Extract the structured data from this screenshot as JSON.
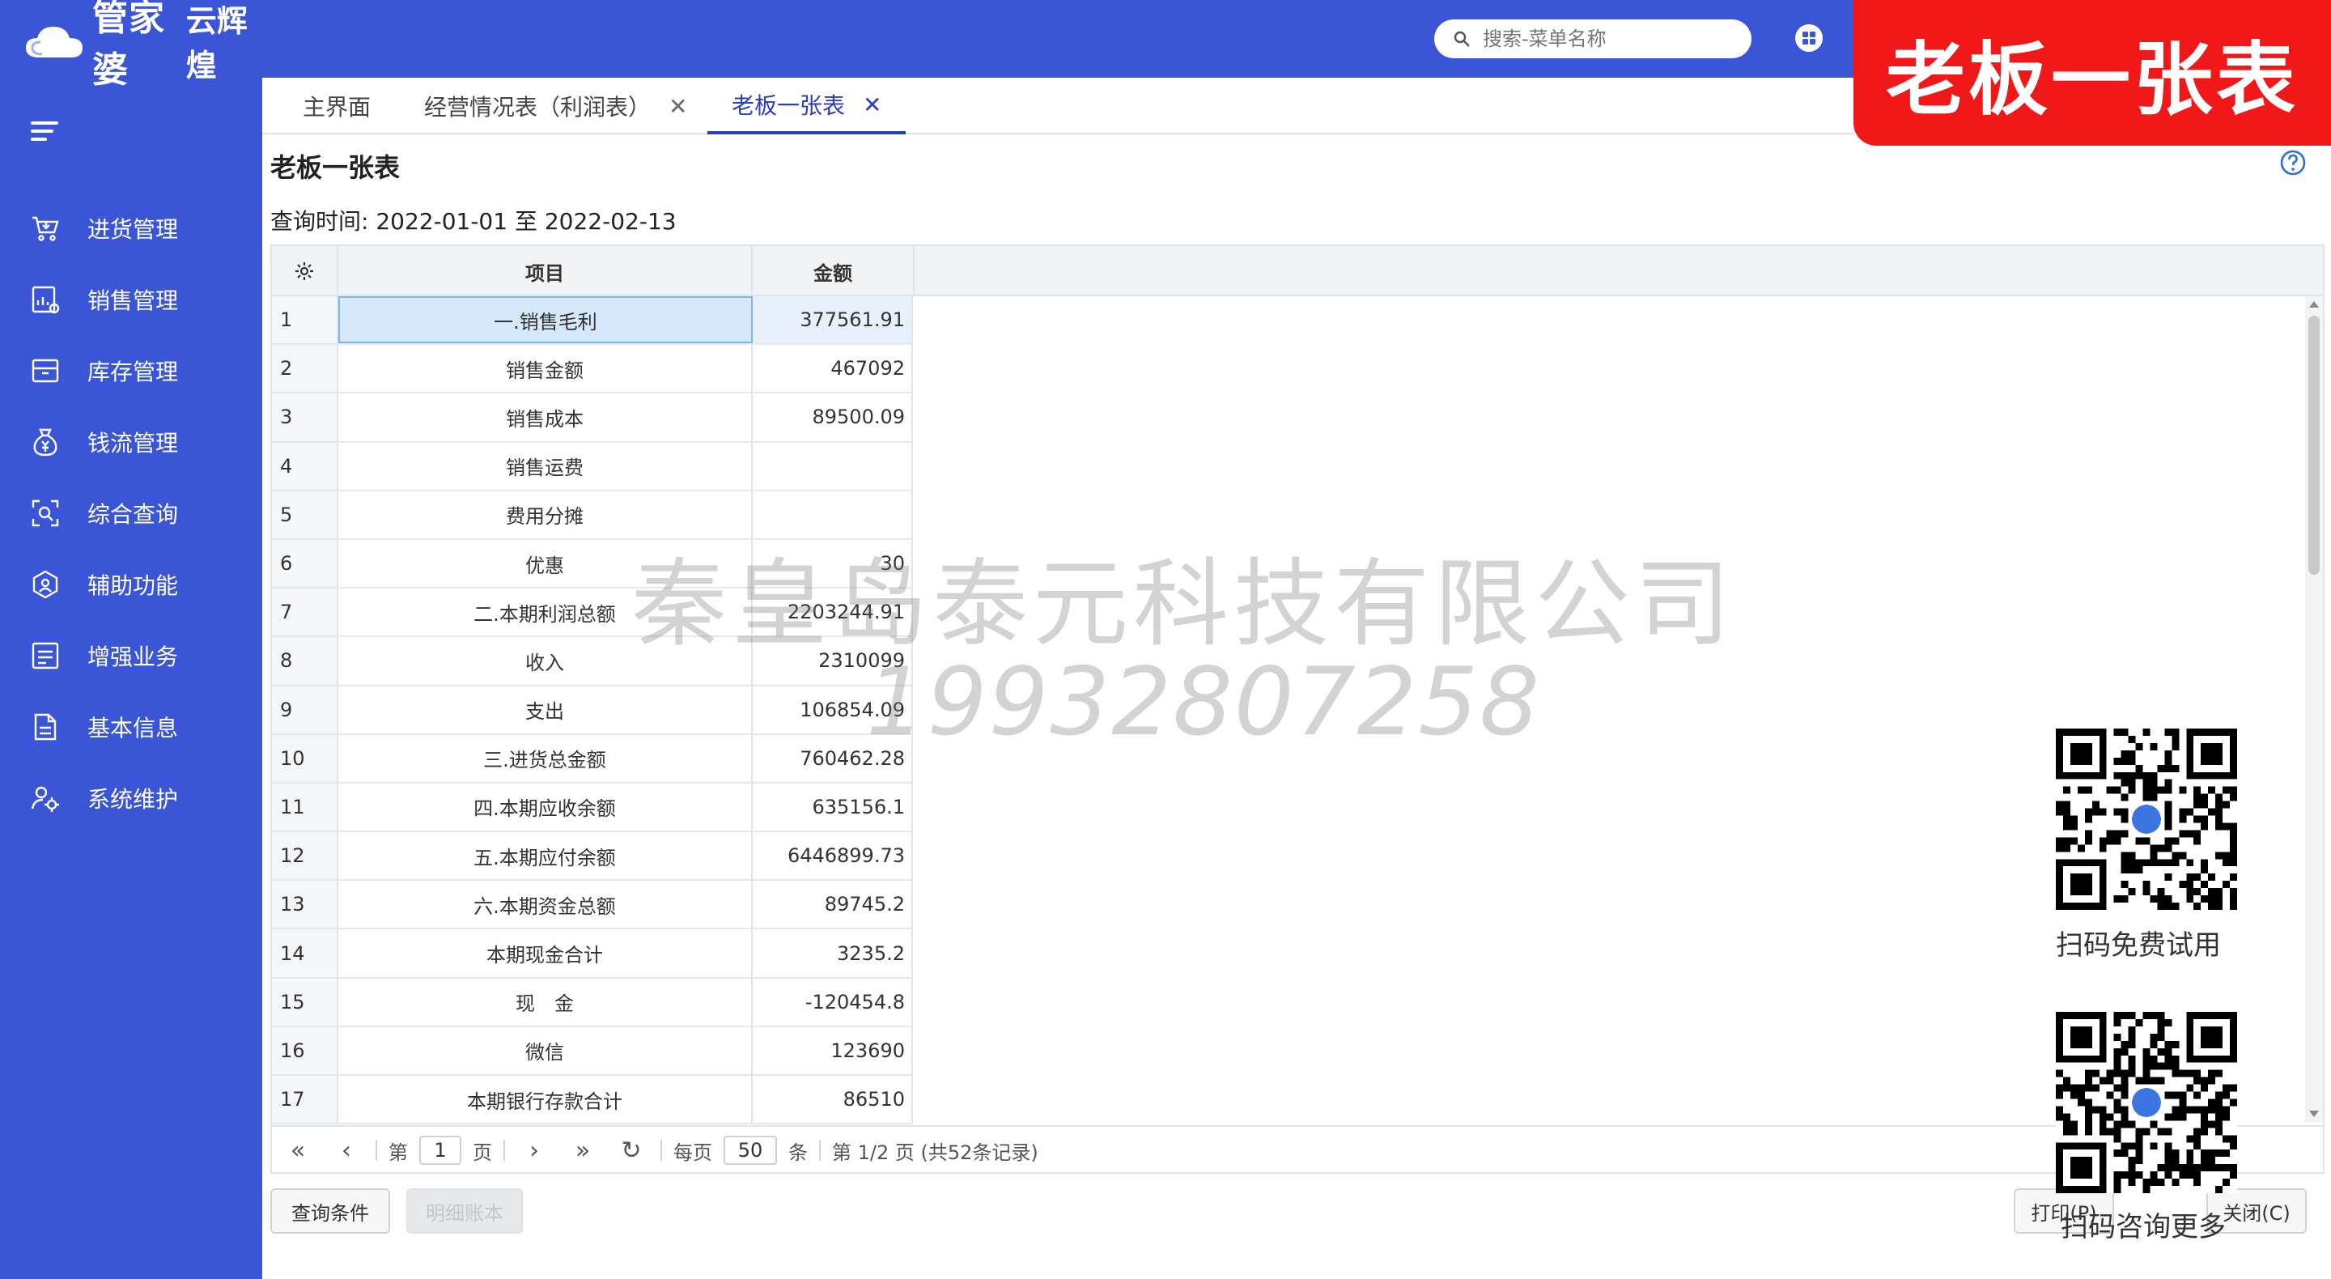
{
  "app": {
    "logo_text": "管家婆",
    "logo_sub": "云辉煌"
  },
  "badge": {
    "text": "老板一张表"
  },
  "search": {
    "placeholder": "搜索-菜单名称"
  },
  "sidebar": {
    "items": [
      {
        "label": "进货管理",
        "icon": "cart-icon"
      },
      {
        "label": "销售管理",
        "icon": "sales-chart-icon"
      },
      {
        "label": "库存管理",
        "icon": "inventory-box-icon"
      },
      {
        "label": "钱流管理",
        "icon": "money-bag-icon"
      },
      {
        "label": "综合查询",
        "icon": "search-frame-icon"
      },
      {
        "label": "辅助功能",
        "icon": "hexagon-icon"
      },
      {
        "label": "增强业务",
        "icon": "document-list-icon"
      },
      {
        "label": "基本信息",
        "icon": "file-icon"
      },
      {
        "label": "系统维护",
        "icon": "users-gear-icon"
      }
    ]
  },
  "tabs": [
    {
      "label": "主界面",
      "closable": false
    },
    {
      "label": "经营情况表（利润表）",
      "closable": true
    },
    {
      "label": "老板一张表",
      "closable": true,
      "active": true
    }
  ],
  "page": {
    "title": "老板一张表",
    "query_time": "查询时间: 2022-01-01 至 2022-02-13"
  },
  "table": {
    "headers": {
      "item": "项目",
      "amount": "金额"
    },
    "rows": [
      {
        "idx": "1",
        "item": "一.销售毛利",
        "amount": "377561.91"
      },
      {
        "idx": "2",
        "item": "销售金额",
        "amount": "467092"
      },
      {
        "idx": "3",
        "item": "销售成本",
        "amount": "89500.09"
      },
      {
        "idx": "4",
        "item": "销售运费",
        "amount": ""
      },
      {
        "idx": "5",
        "item": "费用分摊",
        "amount": ""
      },
      {
        "idx": "6",
        "item": "优惠",
        "amount": "30"
      },
      {
        "idx": "7",
        "item": "二.本期利润总额",
        "amount": "2203244.91"
      },
      {
        "idx": "8",
        "item": "收入",
        "amount": "2310099"
      },
      {
        "idx": "9",
        "item": "支出",
        "amount": "106854.09"
      },
      {
        "idx": "10",
        "item": "三.进货总金额",
        "amount": "760462.28"
      },
      {
        "idx": "11",
        "item": "四.本期应收余额",
        "amount": "635156.1"
      },
      {
        "idx": "12",
        "item": "五.本期应付余额",
        "amount": "6446899.73"
      },
      {
        "idx": "13",
        "item": "六.本期资金总额",
        "amount": "89745.2"
      },
      {
        "idx": "14",
        "item": "本期现金合计",
        "amount": "3235.2"
      },
      {
        "idx": "15",
        "item": "现　金",
        "amount": "-120454.8"
      },
      {
        "idx": "16",
        "item": "微信",
        "amount": "123690"
      },
      {
        "idx": "17",
        "item": "本期银行存款合计",
        "amount": "86510"
      }
    ]
  },
  "pager": {
    "page_prefix": "第",
    "page_value": "1",
    "page_suffix": "页",
    "per_page_label": "每页",
    "per_page_value": "50",
    "per_page_unit": "条",
    "summary": "第 1/2 页 (共52条记录)"
  },
  "buttons": {
    "query": "查询条件",
    "detail": "明细账本",
    "print": "打印(P)",
    "close": "关闭(C)"
  },
  "watermark": {
    "company": "秦皇岛泰元科技有限公司",
    "phone": "19932807258"
  },
  "qr": {
    "trial_label": "扫码免费试用",
    "consult_label": "扫码咨询更多"
  }
}
